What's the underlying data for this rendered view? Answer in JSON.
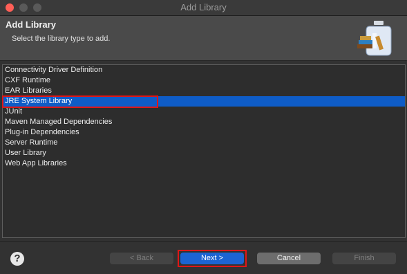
{
  "window": {
    "title": "Add Library"
  },
  "header": {
    "title": "Add Library",
    "subtitle": "Select the library type to add."
  },
  "library_types": [
    {
      "label": "Connectivity Driver Definition",
      "selected": false
    },
    {
      "label": "CXF Runtime",
      "selected": false
    },
    {
      "label": "EAR Libraries",
      "selected": false
    },
    {
      "label": "JRE System Library",
      "selected": true
    },
    {
      "label": "JUnit",
      "selected": false
    },
    {
      "label": "Maven Managed Dependencies",
      "selected": false
    },
    {
      "label": "Plug-in Dependencies",
      "selected": false
    },
    {
      "label": "Server Runtime",
      "selected": false
    },
    {
      "label": "User Library",
      "selected": false
    },
    {
      "label": "Web App Libraries",
      "selected": false
    }
  ],
  "footer": {
    "help_label": "?",
    "back_label": "< Back",
    "next_label": "Next >",
    "cancel_label": "Cancel",
    "finish_label": "Finish"
  },
  "colors": {
    "selection": "#0e5cc7",
    "annotation_border": "#e01616",
    "primary_button": "#1c64d2"
  }
}
